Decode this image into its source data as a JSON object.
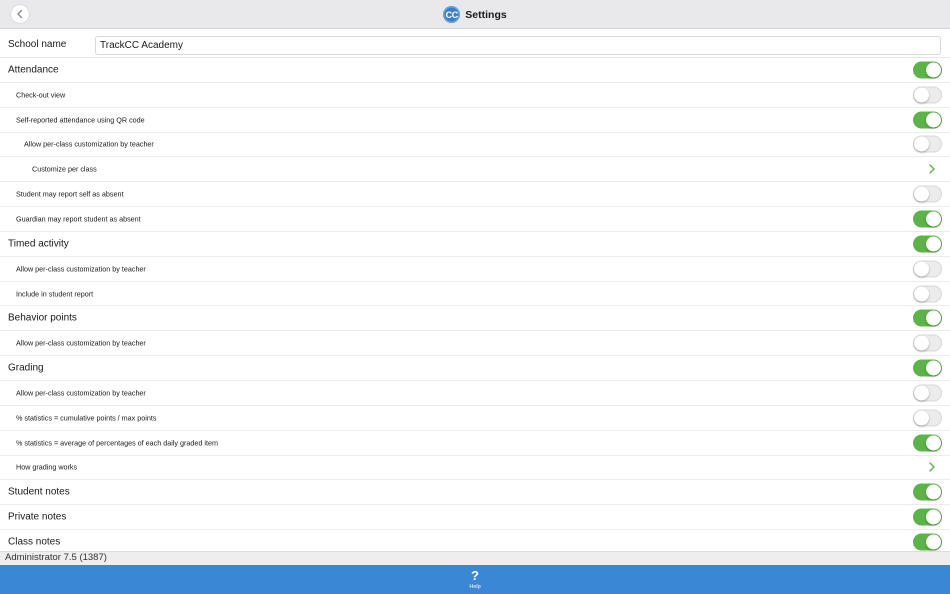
{
  "header": {
    "logo_text": "CC",
    "title": "Settings"
  },
  "school": {
    "label": "School name",
    "value": "TrackCC Academy"
  },
  "rows": [
    {
      "label": "Attendance",
      "level": 0,
      "control": "toggle",
      "on": true
    },
    {
      "label": "Check-out view",
      "level": 1,
      "control": "toggle",
      "on": false
    },
    {
      "label": "Self-reported attendance using QR code",
      "level": 1,
      "control": "toggle",
      "on": true
    },
    {
      "label": "Allow per-class customization by teacher",
      "level": 2,
      "control": "toggle",
      "on": false
    },
    {
      "label": "Customize per class",
      "level": 3,
      "control": "chevron"
    },
    {
      "label": "Student may report self as absent",
      "level": 1,
      "control": "toggle",
      "on": false
    },
    {
      "label": "Guardian may report student as absent",
      "level": 1,
      "control": "toggle",
      "on": true
    },
    {
      "label": "Timed activity",
      "level": 0,
      "control": "toggle",
      "on": true
    },
    {
      "label": "Allow per-class customization by teacher",
      "level": 1,
      "control": "toggle",
      "on": false
    },
    {
      "label": "Include in student report",
      "level": 1,
      "control": "toggle",
      "on": false
    },
    {
      "label": "Behavior points",
      "level": 0,
      "control": "toggle",
      "on": true
    },
    {
      "label": "Allow per-class customization by teacher",
      "level": 1,
      "control": "toggle",
      "on": false
    },
    {
      "label": "Grading",
      "level": 0,
      "control": "toggle",
      "on": true
    },
    {
      "label": "Allow per-class customization by teacher",
      "level": 1,
      "control": "toggle",
      "on": false
    },
    {
      "label": "% statistics = cumulative points / max points",
      "level": 1,
      "control": "toggle",
      "on": false
    },
    {
      "label": "% statistics = average of percentages of each daily graded item",
      "level": 1,
      "control": "toggle",
      "on": true
    },
    {
      "label": "How grading works",
      "level": 1,
      "control": "chevron"
    },
    {
      "label": "Student notes",
      "level": 0,
      "control": "toggle",
      "on": true
    },
    {
      "label": "Private notes",
      "level": 0,
      "control": "toggle",
      "on": true
    },
    {
      "label": "Class notes",
      "level": 0,
      "control": "toggle",
      "on": true
    }
  ],
  "footer": {
    "version": "Administrator 7.5 (1387)"
  },
  "bottom_bar": {
    "help_icon": "?",
    "help_label": "Help"
  },
  "colors": {
    "toggle_on": "#5bb445",
    "chevron": "#5bb445",
    "bottom_bar": "#3a87d6",
    "logo": "#3a7fc4"
  }
}
